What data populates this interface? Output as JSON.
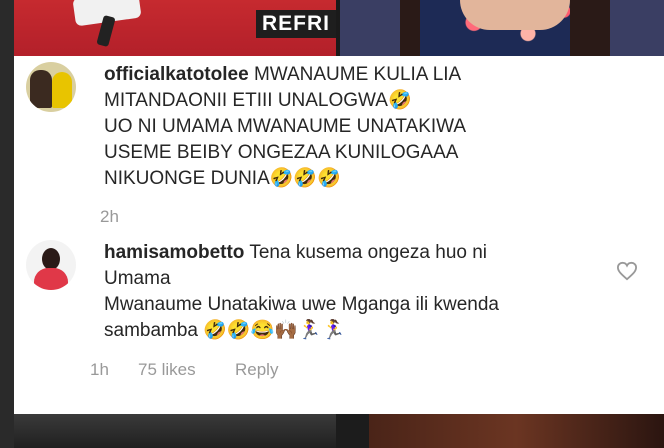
{
  "photo_overlay_text": "REFRI",
  "comments": [
    {
      "username": "officialkatotolee",
      "lines": [
        "MWANAUME KULIA LIA",
        "MITANDAONII ETIII UNALOGWA🤣",
        "UO NI UMAMA MWANAUME UNATAKIWA",
        "USEME BEIBY ONGEZAA KUNILOGAAA",
        "NIKUONGE DUNIA🤣🤣🤣"
      ],
      "time": "2h"
    },
    {
      "username": "hamisamobetto",
      "lines": [
        "Tena kusema ongeza huo ni",
        "Umama",
        "Mwanaume Unatakiwa uwe Mganga ili kwenda",
        "sambamba 🤣🤣😂🙌🏾🏃‍♀️🏃‍♀️"
      ],
      "time": "1h",
      "likes": "75 likes",
      "reply": "Reply",
      "like_icon": "heart-outline-icon"
    }
  ]
}
